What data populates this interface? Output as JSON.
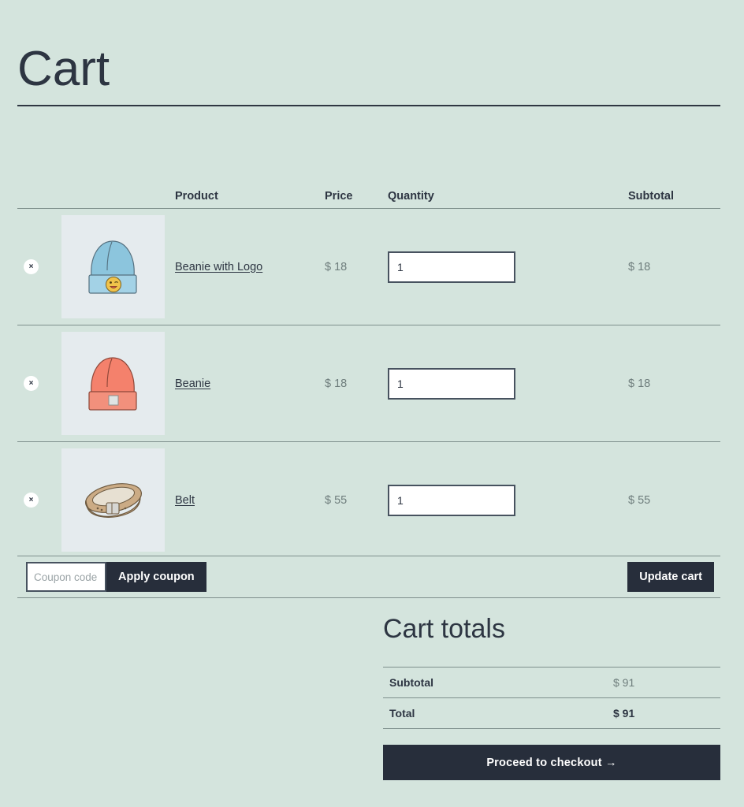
{
  "page": {
    "title": "Cart",
    "background_color": "#d4e4dd",
    "accent_dark": "#272e3b",
    "thumb_background": "#e5ebee"
  },
  "cart_table": {
    "headers": {
      "remove": "",
      "thumbnail": "",
      "product": "Product",
      "price": "Price",
      "quantity": "Quantity",
      "subtotal": "Subtotal"
    },
    "rows": [
      {
        "remove_label": "×",
        "image": "blue-beanie-with-logo",
        "name": "Beanie with Logo",
        "price": "$ 18",
        "quantity": "1",
        "subtotal": "$ 18"
      },
      {
        "remove_label": "×",
        "image": "red-beanie",
        "name": "Beanie",
        "price": "$ 18",
        "quantity": "1",
        "subtotal": "$ 18"
      },
      {
        "remove_label": "×",
        "image": "tan-belt",
        "name": "Belt",
        "price": "$ 55",
        "quantity": "1",
        "subtotal": "$ 55"
      }
    ]
  },
  "coupon": {
    "placeholder": "Coupon code",
    "value": "",
    "apply_label": "Apply coupon",
    "update_label": "Update cart"
  },
  "totals": {
    "title": "Cart totals",
    "rows": [
      {
        "label": "Subtotal",
        "value": "$ 91"
      },
      {
        "label": "Total",
        "value": "$ 91"
      }
    ],
    "checkout_label": "Proceed to checkout  →"
  }
}
